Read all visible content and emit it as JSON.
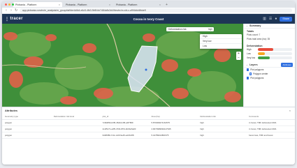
{
  "browser": {
    "tabs": [
      {
        "label": "Pixbania - Platform",
        "active": true
      },
      {
        "label": "Pixbania - Platform",
        "active": false
      },
      {
        "label": "Pixbania - Platform",
        "active": false
      }
    ],
    "new_tab_symbol": "+",
    "url": "app.pixbania.com/m/m_analysis/m_group/da9de4d4b4-e6c5-4fb3-9b9f-bb7484a9c3d4/thm/ec/m-shi-c-a9f4b4d4fbde9"
  },
  "header": {
    "logo": "tracer",
    "title": "Cocoa in Ivory Coast",
    "share_label": "Share",
    "icons": [
      "chart-icon",
      "list-icon",
      "user-icon"
    ]
  },
  "map": {
    "search_label": "Deforestation risk",
    "search_value": "high",
    "dropdown_options": [
      "High",
      "Very low",
      "Low"
    ],
    "zoom_in": "+",
    "zoom_out": "−"
  },
  "panel": {
    "summary": {
      "title": "Summary",
      "totals_label": "Totals",
      "plots_count": "Plots count: 7",
      "plots_area": "Plots total area (ha): 35"
    },
    "deforestation": {
      "title": "Deforestation",
      "rows": [
        {
          "label": "High",
          "percent": 45,
          "color": "#e74c3c"
        },
        {
          "label": "Low",
          "percent": 20,
          "color": "#f5a623"
        },
        {
          "label": "Very low",
          "percent": 35,
          "color": "#43a047"
        }
      ]
    },
    "layers": {
      "title": "Layers",
      "attributes_label": "Attributes",
      "items": [
        {
          "label": "Plot polygons",
          "type": "checkbox"
        },
        {
          "label": "Polygon center",
          "type": "swatch"
        },
        {
          "label": "Plot polygons",
          "type": "checkbox"
        }
      ]
    }
  },
  "attributes": {
    "title": "Attributes",
    "close": "×",
    "columns": [
      "Geometry type",
      "Deforestation risk level",
      "plot_id",
      "Area (ha)",
      "Deforestation risk",
      "Comments"
    ],
    "rows": [
      [
        "polygon",
        "",
        "7c8d0f9b-b0f5-45d0-b4f5-a0f7f9f9",
        "5.870009274161575",
        "high",
        "in forest, TMF deforested 2021"
      ],
      [
        "polygon",
        "",
        "4cdf5c71-a3f5-4704-8f7d-4b00e5a00",
        "4.9070999994147945",
        "high",
        "in forest, TMF deforested 2021"
      ],
      [
        "polygon",
        "",
        "6d0f6f80-7c4c-4c0f-9e45-a4c5c0f8",
        "5.44789013861575",
        "high",
        "forest loss, TMF and forest"
      ]
    ]
  },
  "colors": {
    "header_bg": "#1e3555",
    "accent": "#2f6fe0",
    "deforestation_high": "#e74c3c",
    "forest": "#3f8f3a",
    "polygon": "#d9e4f2"
  }
}
